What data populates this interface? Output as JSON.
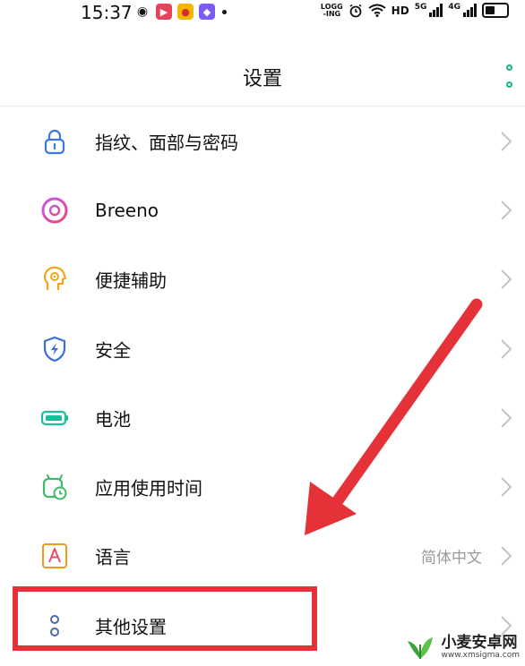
{
  "status_bar": {
    "time": "15:37",
    "logging_label_top": "LOGG",
    "logging_label_bottom": "-ING",
    "hd_label": "HD",
    "net_label_1": "5G",
    "net_label_2": "4G",
    "app_icons": [
      "wechat-icon",
      "video-app-icon",
      "weibo-icon",
      "gallery-app-icon"
    ]
  },
  "header": {
    "title": "设置"
  },
  "settings_items": [
    {
      "label": "指纹、面部与密码",
      "icon": "lock-icon",
      "value": ""
    },
    {
      "label": "Breeno",
      "icon": "breeno-icon",
      "value": ""
    },
    {
      "label": "便捷辅助",
      "icon": "head-assist-icon",
      "value": ""
    },
    {
      "label": "安全",
      "icon": "shield-bolt-icon",
      "value": ""
    },
    {
      "label": "电池",
      "icon": "battery-icon",
      "value": ""
    },
    {
      "label": "应用使用时间",
      "icon": "clock-app-icon",
      "value": ""
    },
    {
      "label": "语言",
      "icon": "language-icon",
      "value": "简体中文"
    },
    {
      "label": "其他设置",
      "icon": "more-settings-icon",
      "value": ""
    }
  ],
  "colors": {
    "accent_green": "#18b27b",
    "annotation_red": "#e53238"
  },
  "watermark": {
    "text": "小麦安卓网",
    "url": "www.xmsigma.com"
  }
}
